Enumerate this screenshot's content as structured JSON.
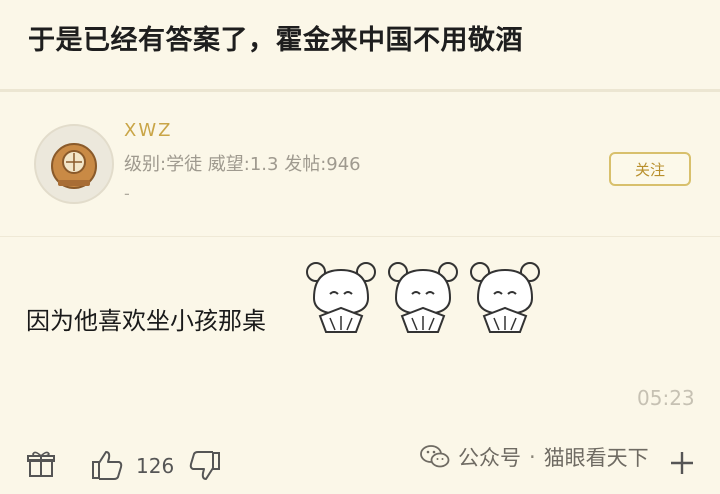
{
  "post": {
    "title": "于是已经有答案了，霍金来中国不用敬酒",
    "author": {
      "username": "XWZ",
      "stats": "级别:学徒 威望:1.3 发帖:946",
      "extra": "-"
    },
    "follow_label": "关注",
    "content": "因为他喜欢坐小孩那桌",
    "time": "05:23",
    "like_count": "126"
  },
  "watermark": {
    "source": "公众号",
    "separator": "·",
    "name": "猫眼看天下"
  },
  "icons": [
    "helmet-avatar-icon",
    "anime-girl-sticker",
    "gift-icon",
    "thumbs-up-icon",
    "thumbs-down-icon",
    "wechat-icon",
    "plus-icon"
  ],
  "colors": {
    "background": "#fbf7e8",
    "accent": "#c9a547",
    "follow_border": "#d8c06c"
  }
}
